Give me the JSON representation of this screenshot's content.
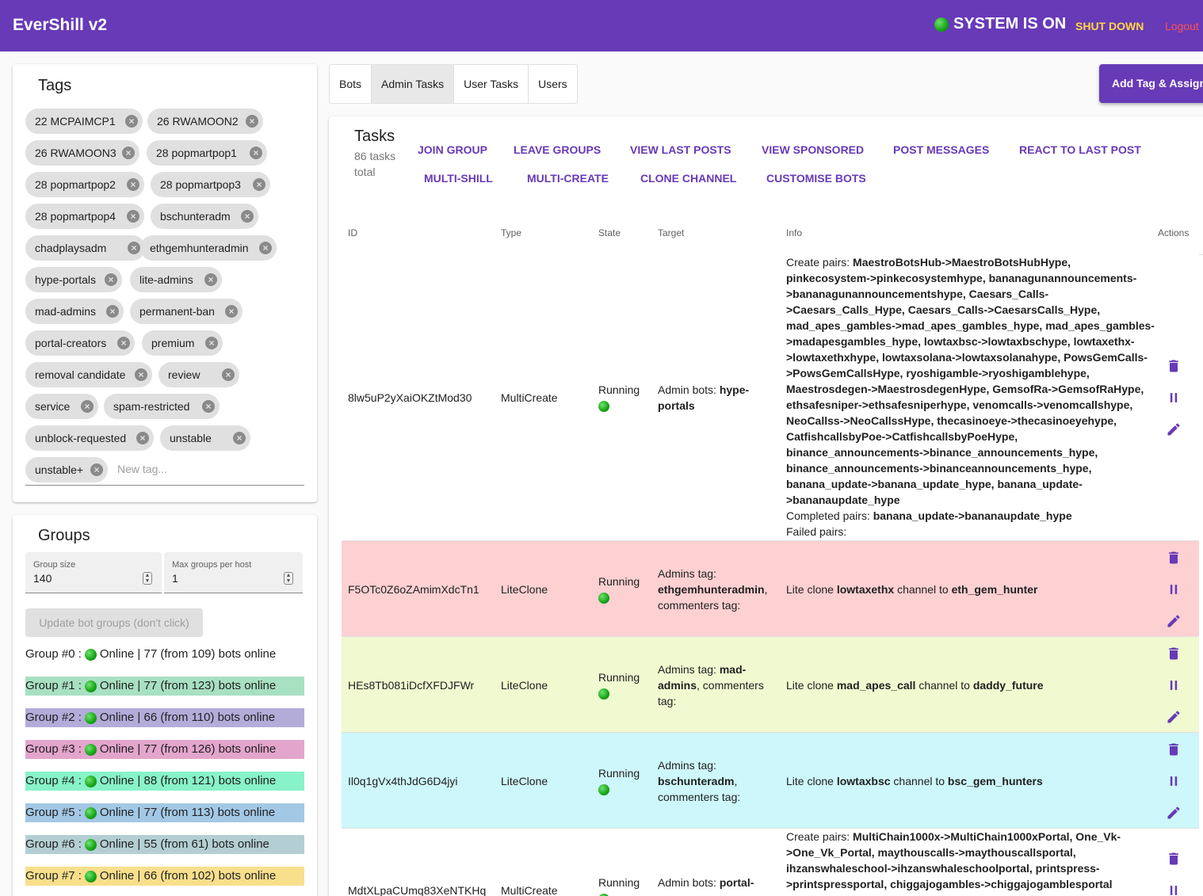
{
  "appbar": {
    "title": "EverShill v2",
    "system_status": "SYSTEM IS ON",
    "shutdown_label": "SHUT DOWN",
    "logout_label": "Logout"
  },
  "tags": {
    "title": "Tags",
    "items": [
      "22 MCPAIMCP1",
      "26 RWAMOON2",
      "26 RWAMOON3",
      "28 popmartpop1",
      "28 popmartpop2",
      "28 popmartpop3",
      "28 popmartpop4",
      "bschunteradm",
      "chadplaysadm",
      "ethgemhunteradmin",
      "hype-portals",
      "lite-admins",
      "mad-admins",
      "permanent-ban",
      "portal-creators",
      "premium",
      "removal candidate",
      "review",
      "service",
      "spam-restricted",
      "unblock-requested",
      "unstable",
      "unstable+"
    ],
    "new_tag_placeholder": "New tag..."
  },
  "groups": {
    "title": "Groups",
    "group_size_label": "Group size",
    "group_size_value": "140",
    "max_groups_label": "Max groups per host",
    "max_groups_value": "1",
    "update_button": "Update bot groups (don't click)",
    "items": [
      {
        "prefix": "Group #0 :",
        "text": "Online | 77 (from 109) bots online",
        "color": "transparent"
      },
      {
        "prefix": "Group #1 :",
        "text": "Online | 77 (from 123) bots online",
        "color": "#a8e0c2"
      },
      {
        "prefix": "Group #2 :",
        "text": "Online | 66 (from 110) bots online",
        "color": "#b3acd9"
      },
      {
        "prefix": "Group #3 :",
        "text": "Online | 77 (from 126) bots online",
        "color": "#e3a5cc"
      },
      {
        "prefix": "Group #4 :",
        "text": "Online | 88 (from 121) bots online",
        "color": "#88f2c8"
      },
      {
        "prefix": "Group #5 :",
        "text": "Online | 77 (from 113) bots online",
        "color": "#a3c8e6"
      },
      {
        "prefix": "Group #6 :",
        "text": "Online | 55 (from 61) bots online",
        "color": "#b3cfd3"
      },
      {
        "prefix": "Group #7 :",
        "text": "Online | 66 (from 102) bots online",
        "color": "#f8df8c"
      }
    ]
  },
  "tabs": [
    "Bots",
    "Admin Tasks",
    "User Tasks",
    "Users"
  ],
  "active_tab": "Admin Tasks",
  "add_button": "Add Tag & Assign",
  "tasks": {
    "title": "Tasks",
    "subtitle": "86 tasks total",
    "actions_row1": [
      "JOIN GROUP",
      "LEAVE GROUPS",
      "VIEW LAST POSTS",
      "VIEW SPONSORED",
      "POST MESSAGES",
      "REACT TO LAST POST"
    ],
    "actions_row2": [
      "MULTI-SHILL",
      "MULTI-CREATE",
      "CLONE CHANNEL",
      "CUSTOMISE BOTS"
    ],
    "columns": [
      "ID",
      "Type",
      "State",
      "Target",
      "Info",
      "Actions"
    ],
    "rows": [
      {
        "id": "8lw5uP2yXaiOKZtMod30",
        "type": "MultiCreate",
        "state": "Running",
        "target_label": "Admin bots:",
        "target_value": "hype-portals",
        "info_lines": [
          [
            "Create pairs: ",
            "MaestroBotsHub->MaestroBotsHubHype,"
          ],
          [
            "",
            "pinkecosystem->pinkecosystemhype, bananagunannouncements-"
          ],
          [
            "",
            ">bananagunannouncementshype, Caesars_Calls-"
          ],
          [
            "",
            ">Caesars_Calls_Hype, Caesars_Calls->CaesarsCalls_Hype,"
          ],
          [
            "",
            "mad_apes_gambles->mad_apes_gambles_hype, mad_apes_gambles-"
          ],
          [
            "",
            ">madapesgambles_hype, lowtaxbsc->lowtaxbschype, lowtaxethx-"
          ],
          [
            "",
            ">lowtaxethxhype, lowtaxsolana->lowtaxsolanahype, PowsGemCalls-"
          ],
          [
            "",
            ">PowsGemCallsHype, ryoshigamble->ryoshigamblehype,"
          ],
          [
            "",
            "Maestrosdegen->MaestrosdegenHype, GemsofRa->GemsofRaHype,"
          ],
          [
            "",
            "ethsafesniper->ethsafesniperhype, venomcalls->venomcallshype,"
          ],
          [
            "",
            "NeoCallss->NeoCallssHype, thecasinoeye->thecasinoeyehype,"
          ],
          [
            "",
            "CatfishcallsbyPoe->CatfishcallsbyPoeHype,"
          ],
          [
            "",
            "binance_announcements->binance_announcements_hype,"
          ],
          [
            "",
            "binance_announcements->binanceannouncements_hype,"
          ],
          [
            "",
            "banana_update->banana_update_hype, banana_update-"
          ],
          [
            "",
            ">bananaupdate_hype"
          ],
          [
            "Completed pairs: ",
            "banana_update->bananaupdate_hype"
          ],
          [
            "Failed pairs:",
            ""
          ]
        ],
        "color": "#ffffff"
      },
      {
        "id": "F5OTc0Z6oZAmimXdcTn1",
        "type": "LiteClone",
        "state": "Running",
        "target_lines": [
          [
            "Admins tag:",
            ""
          ],
          [
            "",
            "ethgemhunteradmin",
            ","
          ],
          [
            "commenters tag:",
            ""
          ]
        ],
        "info_lines": [
          [
            "Lite clone ",
            "lowtaxethx",
            " channel to ",
            "eth_gem_hunter"
          ]
        ],
        "color": "#fdd0d2"
      },
      {
        "id": "HEs8Tb081iDcfXFDJFWr",
        "type": "LiteClone",
        "state": "Running",
        "target_lines": [
          [
            "Admins tag: ",
            "mad-"
          ],
          [
            "",
            "admins",
            ", commenters"
          ],
          [
            "tag:",
            ""
          ]
        ],
        "info_lines": [
          [
            "Lite clone ",
            "mad_apes_call",
            " channel to ",
            "daddy_future"
          ]
        ],
        "color": "#f1f9d0"
      },
      {
        "id": "Il0q1gVx4thJdG6D4jyi",
        "type": "LiteClone",
        "state": "Running",
        "target_lines": [
          [
            "Admins tag:",
            ""
          ],
          [
            "",
            "bschunteradm",
            ","
          ],
          [
            "commenters tag:",
            ""
          ]
        ],
        "info_lines": [
          [
            "Lite clone ",
            "lowtaxbsc",
            " channel to ",
            "bsc_gem_hunters"
          ]
        ],
        "color": "#cdf7fb"
      },
      {
        "id": "MdtXLpaCUmq83XeNTKHq",
        "type": "MultiCreate",
        "state": "Running",
        "target_label": "Admin bots:",
        "target_value": "portal-",
        "info_lines": [
          [
            "Create pairs: ",
            "MultiChain1000x->MultiChain1000xPortal, One_Vk-"
          ],
          [
            "",
            ">One_Vk_Portal, maythouscalls->maythouscallsportal,"
          ],
          [
            "",
            "ihzanswhaleschool->ihzanswhaleschoolportal, printspress-"
          ],
          [
            "",
            ">printspressportal, chiggajogambles->chiggajogamblesportal"
          ]
        ],
        "color": "#ffffff"
      }
    ]
  },
  "colors": {
    "primary": "#673ab7",
    "online": "#17a317",
    "shutdown": "#ffd740",
    "logout": "#ff5252"
  }
}
